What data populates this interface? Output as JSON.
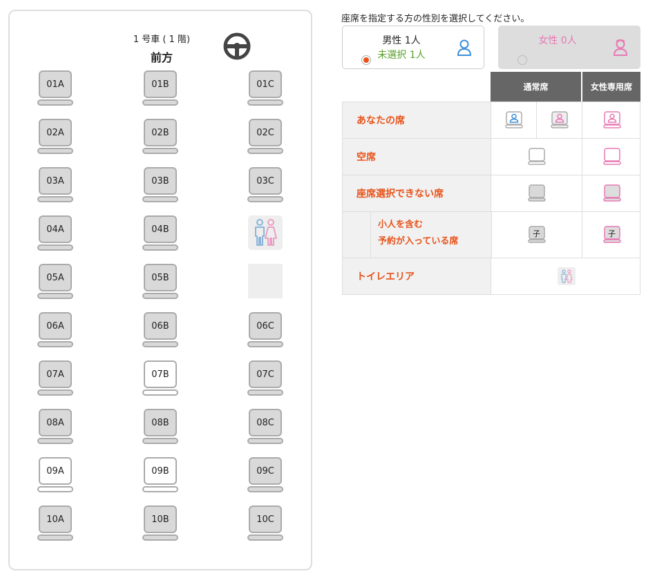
{
  "bus": {
    "car_number": "1 号車 ( 1 階)",
    "front_label": "前方",
    "colors": {
      "occupied": "#d9d9d9",
      "vacant": "#ffffff",
      "border": "#aaaaaa"
    },
    "rows": [
      {
        "seats": [
          {
            "id": "01A",
            "status": "unavailable"
          },
          {
            "id": "01B",
            "status": "unavailable"
          },
          {
            "id": "01C",
            "status": "unavailable"
          }
        ]
      },
      {
        "seats": [
          {
            "id": "02A",
            "status": "unavailable"
          },
          {
            "id": "02B",
            "status": "unavailable"
          },
          {
            "id": "02C",
            "status": "unavailable"
          }
        ]
      },
      {
        "seats": [
          {
            "id": "03A",
            "status": "unavailable"
          },
          {
            "id": "03B",
            "status": "unavailable"
          },
          {
            "id": "03C",
            "status": "unavailable"
          }
        ]
      },
      {
        "seats": [
          {
            "id": "04A",
            "status": "unavailable"
          },
          {
            "id": "04B",
            "status": "unavailable"
          },
          {
            "type": "toilet"
          }
        ]
      },
      {
        "seats": [
          {
            "id": "05A",
            "status": "unavailable"
          },
          {
            "id": "05B",
            "status": "unavailable"
          },
          {
            "type": "blank"
          }
        ]
      },
      {
        "seats": [
          {
            "id": "06A",
            "status": "unavailable"
          },
          {
            "id": "06B",
            "status": "unavailable"
          },
          {
            "id": "06C",
            "status": "unavailable"
          }
        ]
      },
      {
        "seats": [
          {
            "id": "07A",
            "status": "unavailable"
          },
          {
            "id": "07B",
            "status": "vacant"
          },
          {
            "id": "07C",
            "status": "unavailable"
          }
        ]
      },
      {
        "seats": [
          {
            "id": "08A",
            "status": "unavailable"
          },
          {
            "id": "08B",
            "status": "unavailable"
          },
          {
            "id": "08C",
            "status": "unavailable"
          }
        ]
      },
      {
        "seats": [
          {
            "id": "09A",
            "status": "vacant"
          },
          {
            "id": "09B",
            "status": "vacant"
          },
          {
            "id": "09C",
            "status": "unavailable"
          }
        ]
      },
      {
        "seats": [
          {
            "id": "10A",
            "status": "unavailable"
          },
          {
            "id": "10B",
            "status": "unavailable"
          },
          {
            "id": "10C",
            "status": "unavailable"
          }
        ]
      }
    ]
  },
  "selector": {
    "instruction": "座席を指定する方の性別を選択してください。",
    "male": {
      "label": "男性 1人",
      "status": "未選択 1人",
      "icon": "male-person-icon",
      "color": "#3d8fd8",
      "selected": true
    },
    "female": {
      "label": "女性 0人",
      "icon": "female-person-icon",
      "color": "#e878b4",
      "selected": false
    },
    "radio_color": "#e8531a"
  },
  "legend": {
    "header_normal": "通常席",
    "header_female": "女性専用席",
    "your_seat": "あなたの席",
    "vacant": "空席",
    "unavailable": "座席選択できない席",
    "child_line1": "小人を含む",
    "child_line2": "予約が入っている席",
    "child_mark": "子",
    "toilet_area": "トイレエリア",
    "label_color": "#e8531a",
    "female_color": "#e878b4"
  }
}
